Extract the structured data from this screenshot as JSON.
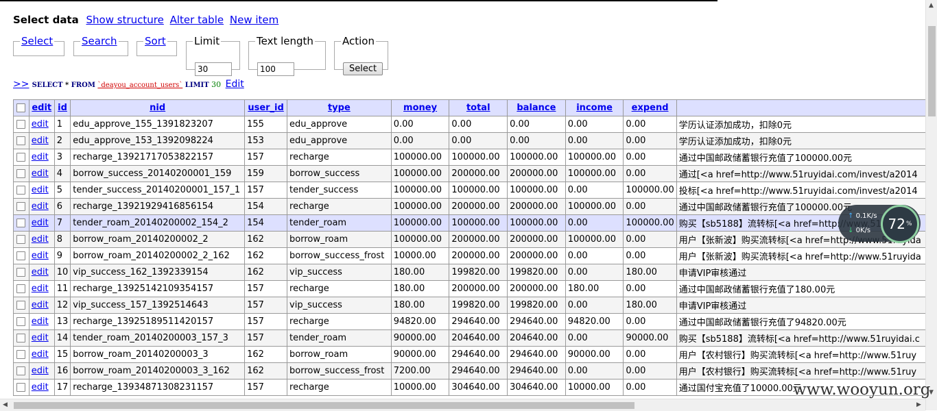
{
  "nav": {
    "current": "Select data",
    "links": [
      "Show structure",
      "Alter table",
      "New item"
    ]
  },
  "controls": {
    "select_legend": "Select",
    "search_legend": "Search",
    "sort_legend": "Sort",
    "limit_legend": "Limit",
    "limit_value": "30",
    "text_length_legend": "Text length",
    "text_length_value": "100",
    "action_legend": "Action",
    "action_button": "Select"
  },
  "sql": {
    "arrow": ">>",
    "select_kw": "SELECT",
    "star": "*",
    "from_kw": "FROM",
    "table": "`deayou_account_users`",
    "limit_kw": "LIMIT",
    "limit_num": "30",
    "edit": "Edit"
  },
  "table": {
    "edit_label": "edit",
    "columns": [
      "id",
      "nid",
      "user_id",
      "type",
      "money",
      "total",
      "balance",
      "income",
      "expend",
      ""
    ],
    "rows": [
      [
        "1",
        "edu_approve_155_1391823207",
        "155",
        "edu_approve",
        "0.00",
        "0.00",
        "0.00",
        "0.00",
        "0.00",
        "学历认证添加成功，扣除0元"
      ],
      [
        "2",
        "edu_approve_153_1392098224",
        "153",
        "edu_approve",
        "0.00",
        "0.00",
        "0.00",
        "0.00",
        "0.00",
        "学历认证添加成功，扣除0元"
      ],
      [
        "3",
        "recharge_13921717053822157",
        "157",
        "recharge",
        "100000.00",
        "100000.00",
        "100000.00",
        "100000.00",
        "0.00",
        "通过中国邮政储蓄银行充值了100000.00元"
      ],
      [
        "4",
        "borrow_success_20140200001_159",
        "159",
        "borrow_success",
        "100000.00",
        "200000.00",
        "200000.00",
        "100000.00",
        "0.00",
        "通过[<a href=http://www.51ruyidai.com/invest/a2014"
      ],
      [
        "5",
        "tender_success_20140200001_157_1",
        "157",
        "tender_success",
        "100000.00",
        "100000.00",
        "100000.00",
        "0.00",
        "100000.00",
        "投标[<a href=http://www.51ruyidai.com/invest/a2014"
      ],
      [
        "6",
        "recharge_13921929416856154",
        "154",
        "recharge",
        "100000.00",
        "200000.00",
        "200000.00",
        "100000.00",
        "0.00",
        "通过中国邮政储蓄银行充值了100000.00元"
      ],
      [
        "7",
        "tender_roam_20140200002_154_2",
        "154",
        "tender_roam",
        "100000.00",
        "100000.00",
        "100000.00",
        "0.00",
        "100000.00",
        "购买【sb5188】流转标[<a href=http://www.51ruyidai.c"
      ],
      [
        "8",
        "borrow_roam_20140200002_2",
        "162",
        "borrow_roam",
        "100000.00",
        "200000.00",
        "200000.00",
        "100000.00",
        "0.00",
        "用户【张新波】购买流转标[<a href=http://www.51ruyida"
      ],
      [
        "9",
        "borrow_roam_20140200002_2_162",
        "162",
        "borrow_success_frost",
        "10000.00",
        "200000.00",
        "200000.00",
        "0.00",
        "0.00",
        "用户【张新波】购买流转标[<a href=http://www.51ruyida"
      ],
      [
        "10",
        "vip_success_162_1392339154",
        "162",
        "vip_success",
        "180.00",
        "199820.00",
        "199820.00",
        "0.00",
        "180.00",
        "申请VIP审核通过"
      ],
      [
        "11",
        "recharge_13925142109354157",
        "157",
        "recharge",
        "180.00",
        "200000.00",
        "200000.00",
        "180.00",
        "0.00",
        "通过中国邮政储蓄银行充值了180.00元"
      ],
      [
        "12",
        "vip_success_157_1392514643",
        "157",
        "vip_success",
        "180.00",
        "199820.00",
        "199820.00",
        "0.00",
        "180.00",
        "申请VIP审核通过"
      ],
      [
        "13",
        "recharge_13925189511420157",
        "157",
        "recharge",
        "94820.00",
        "294640.00",
        "294640.00",
        "94820.00",
        "0.00",
        "通过中国邮政储蓄银行充值了94820.00元"
      ],
      [
        "14",
        "tender_roam_20140200003_157_3",
        "157",
        "tender_roam",
        "90000.00",
        "204640.00",
        "204640.00",
        "0.00",
        "90000.00",
        "购买【sb5188】流转标[<a href=http://www.51ruyidai.c"
      ],
      [
        "15",
        "borrow_roam_20140200003_3",
        "162",
        "borrow_roam",
        "90000.00",
        "294640.00",
        "294640.00",
        "90000.00",
        "0.00",
        "用户【农村银行】购买流转标[<a href=http://www.51ruy"
      ],
      [
        "16",
        "borrow_roam_20140200003_3_162",
        "162",
        "borrow_success_frost",
        "7200.00",
        "294640.00",
        "294640.00",
        "0.00",
        "0.00",
        "用户【农村银行】购买流转标[<a href=http://www.51ruy"
      ],
      [
        "17",
        "recharge_13934871308231157",
        "157",
        "recharge",
        "10000.00",
        "304640.00",
        "304640.00",
        "10000.00",
        "0.00",
        "通过国付宝充值了10000.00元"
      ]
    ],
    "highlighted_row": 7
  },
  "net_widget": {
    "up": "0.1K/s",
    "down": "0K/s",
    "percent": "72",
    "percent_unit": "%"
  },
  "watermark": "www.wooyun.org"
}
